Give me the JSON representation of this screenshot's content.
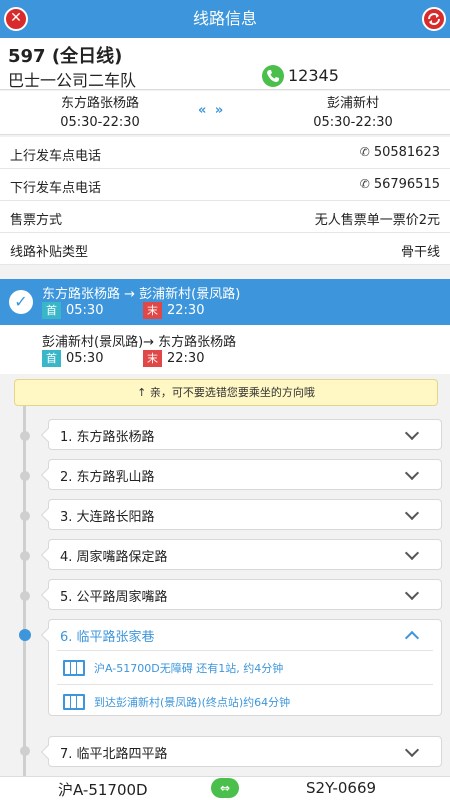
{
  "topbar": {
    "title": "线路信息",
    "close_icon": "close-icon",
    "refresh_icon": "refresh-icon"
  },
  "line": {
    "name": "597 (全日线)",
    "company": "巴士一公司二车队",
    "phone": "12345"
  },
  "terminals": {
    "start": {
      "name": "东方路张杨路",
      "hours": "05:30-22:30"
    },
    "end": {
      "name": "彭浦新村",
      "hours": "05:30-22:30"
    },
    "swap_symbol": "«  »"
  },
  "info": [
    {
      "label": "上行发车点电话",
      "value": "50581623"
    },
    {
      "label": "下行发车点电话",
      "value": "56796515"
    },
    {
      "label": "售票方式",
      "value": "无人售票单一票价2元"
    },
    {
      "label": "线路补贴类型",
      "value": "骨干线"
    }
  ],
  "directions": [
    {
      "route": "东方路张杨路 → 彭浦新村(景凤路)",
      "first_tag": "首",
      "first_time": "05:30",
      "last_tag": "末",
      "last_time": "22:30",
      "selected": true
    },
    {
      "route": "彭浦新村(景凤路)→ 东方路张杨路",
      "first_tag": "首",
      "first_time": "05:30",
      "last_tag": "末",
      "last_time": "22:30",
      "selected": false
    }
  ],
  "tip": "↑ 亲，可不要选错您要乘坐的方向哦",
  "stops": [
    {
      "name": "1. 东方路张杨路"
    },
    {
      "name": "2. 东方路乳山路"
    },
    {
      "name": "3. 大连路长阳路"
    },
    {
      "name": "4. 周家嘴路保定路"
    },
    {
      "name": "5. 公平路周家嘴路"
    },
    {
      "name": "6. 临平路张家巷"
    },
    {
      "name": "7. 临平北路四平路"
    }
  ],
  "expanded_stop": {
    "bus_info": "沪A-51700D无障碍 还有1站, 约4分钟",
    "arrival_info": "到达彭浦新村(景凤路)(终点站)约64分钟"
  },
  "bottombar": {
    "plate_left": "沪A-51700D",
    "plate_right": "S2Y-0669",
    "switch_symbol": "⇔"
  },
  "colors": {
    "primary": "#3d96db",
    "danger": "#d92b2b",
    "phone_green": "#4bbf4b",
    "first_tag": "#3ab6c9",
    "last_tag": "#e04848"
  }
}
